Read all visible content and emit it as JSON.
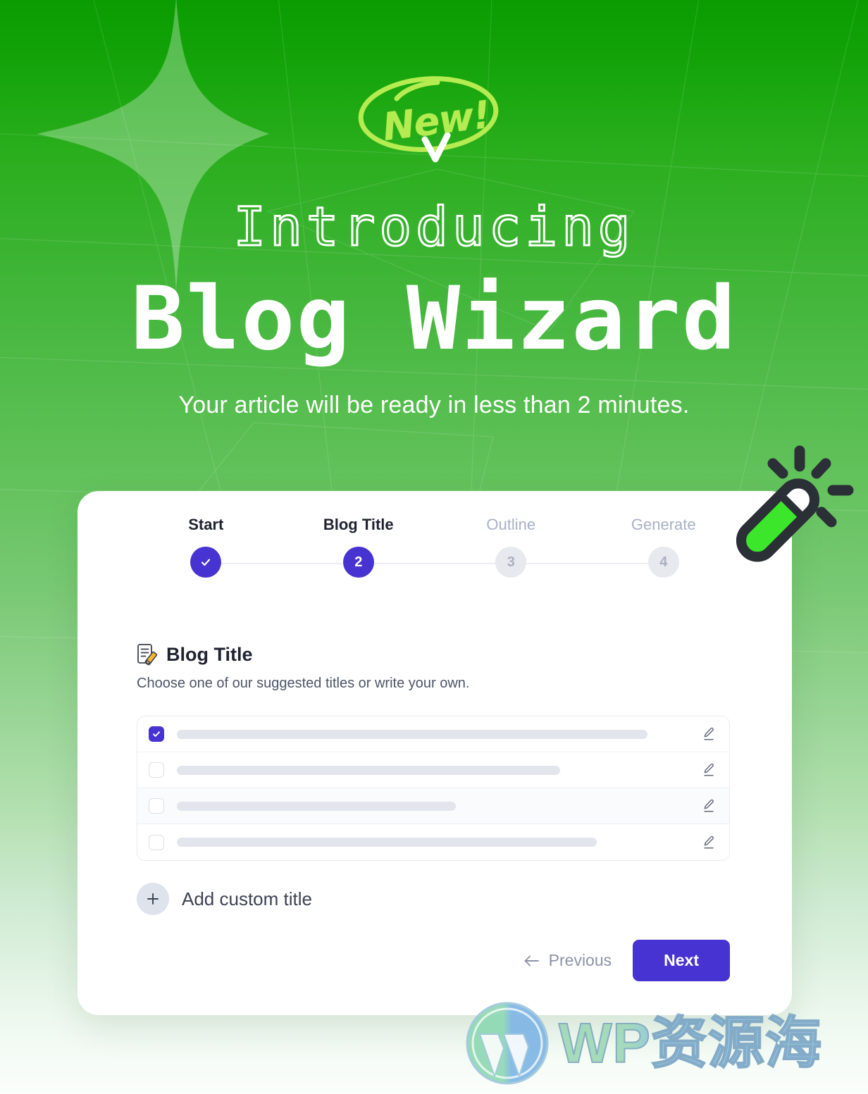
{
  "hero": {
    "badge_text": "New!",
    "badge_icon": "check-mark",
    "eyebrow": "Introducing",
    "title": "Blog Wizard",
    "subtitle": "Your article will be ready in less than 2 minutes.",
    "sparkle_icon": "sparkle-star-icon",
    "wand_icon": "magic-wand-icon",
    "colors": {
      "bg_top": "#0a9c00",
      "bg_bottom": "#fbfefb",
      "badge_green": "#b4ec51",
      "wand_green": "#3ce62b",
      "wand_outline": "#2b2f36"
    }
  },
  "wizard": {
    "steps": [
      {
        "label": "Start",
        "marker": "✓",
        "state": "done"
      },
      {
        "label": "Blog Title",
        "marker": "2",
        "state": "active"
      },
      {
        "label": "Outline",
        "marker": "3",
        "state": "todo"
      },
      {
        "label": "Generate",
        "marker": "4",
        "state": "todo"
      }
    ],
    "section": {
      "icon": "memo-pencil-icon",
      "title": "Blog Title",
      "description": "Choose one of our suggested titles or write your own."
    },
    "title_options": [
      {
        "checked": true,
        "skeleton_width": 668,
        "edit_icon": "pencil-edit-icon"
      },
      {
        "checked": false,
        "skeleton_width": 544,
        "edit_icon": "pencil-edit-icon"
      },
      {
        "checked": false,
        "skeleton_width": 396,
        "edit_icon": "pencil-edit-icon"
      },
      {
        "checked": false,
        "skeleton_width": 596,
        "edit_icon": "pencil-edit-icon"
      }
    ],
    "add_custom": {
      "icon": "plus-icon",
      "label": "Add custom title"
    },
    "footer": {
      "previous_label": "Previous",
      "previous_icon": "arrow-left-icon",
      "next_label": "Next"
    },
    "accent_color": "#4733d1"
  },
  "watermark": {
    "logo_icon": "wordpress-logo-icon",
    "text": "WP资源海"
  }
}
